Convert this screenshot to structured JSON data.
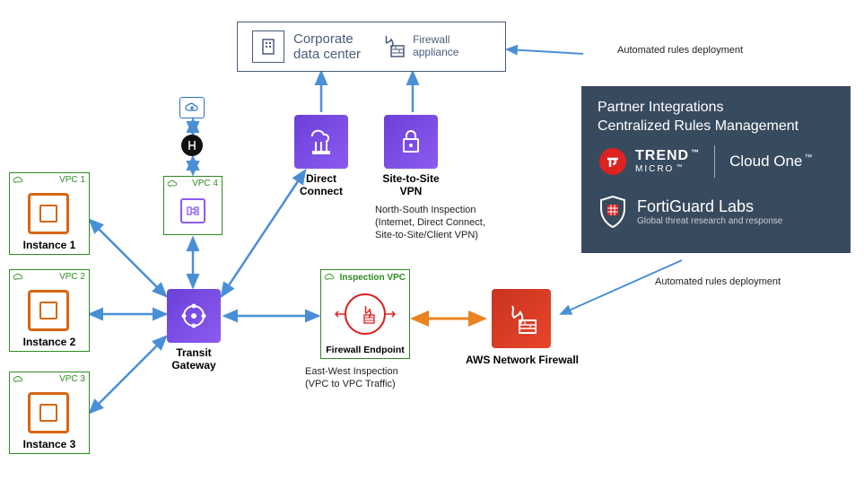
{
  "vpcs": [
    {
      "name": "VPC 1",
      "instance": "Instance 1"
    },
    {
      "name": "VPC 2",
      "instance": "Instance 2"
    },
    {
      "name": "VPC 3",
      "instance": "Instance 3"
    },
    {
      "name": "VPC 4",
      "instance": ""
    }
  ],
  "corp": {
    "title": "Corporate",
    "subtitle": "data center",
    "appliance_line1": "Firewall",
    "appliance_line2": "appliance"
  },
  "services": {
    "direct_connect": "Direct\nConnect",
    "site_vpn": "Site-to-Site\nVPN",
    "transit_gateway": "Transit\nGateway",
    "firewall_endpoint": "Firewall Endpoint",
    "aws_nfw": "AWS Network Firewall"
  },
  "inspection": {
    "vpc_label": "Inspection VPC",
    "ns_line1": "North-South Inspection",
    "ns_line2": "(Internet, Direct Connect,",
    "ns_line3": "Site-to-Site/Client VPN)",
    "ew_line1": "East-West Inspection",
    "ew_line2": "(VPC to VPC Traffic)"
  },
  "partner": {
    "title_line1": "Partner Integrations",
    "title_line2": "Centralized Rules Management",
    "trend_top": "TREND",
    "trend_bottom": "MICRO",
    "cloud_one": "Cloud One",
    "forti": "FortiGuard Labs",
    "forti_sub": "Global threat research and response",
    "deploy_label": "Automated rules deployment"
  }
}
